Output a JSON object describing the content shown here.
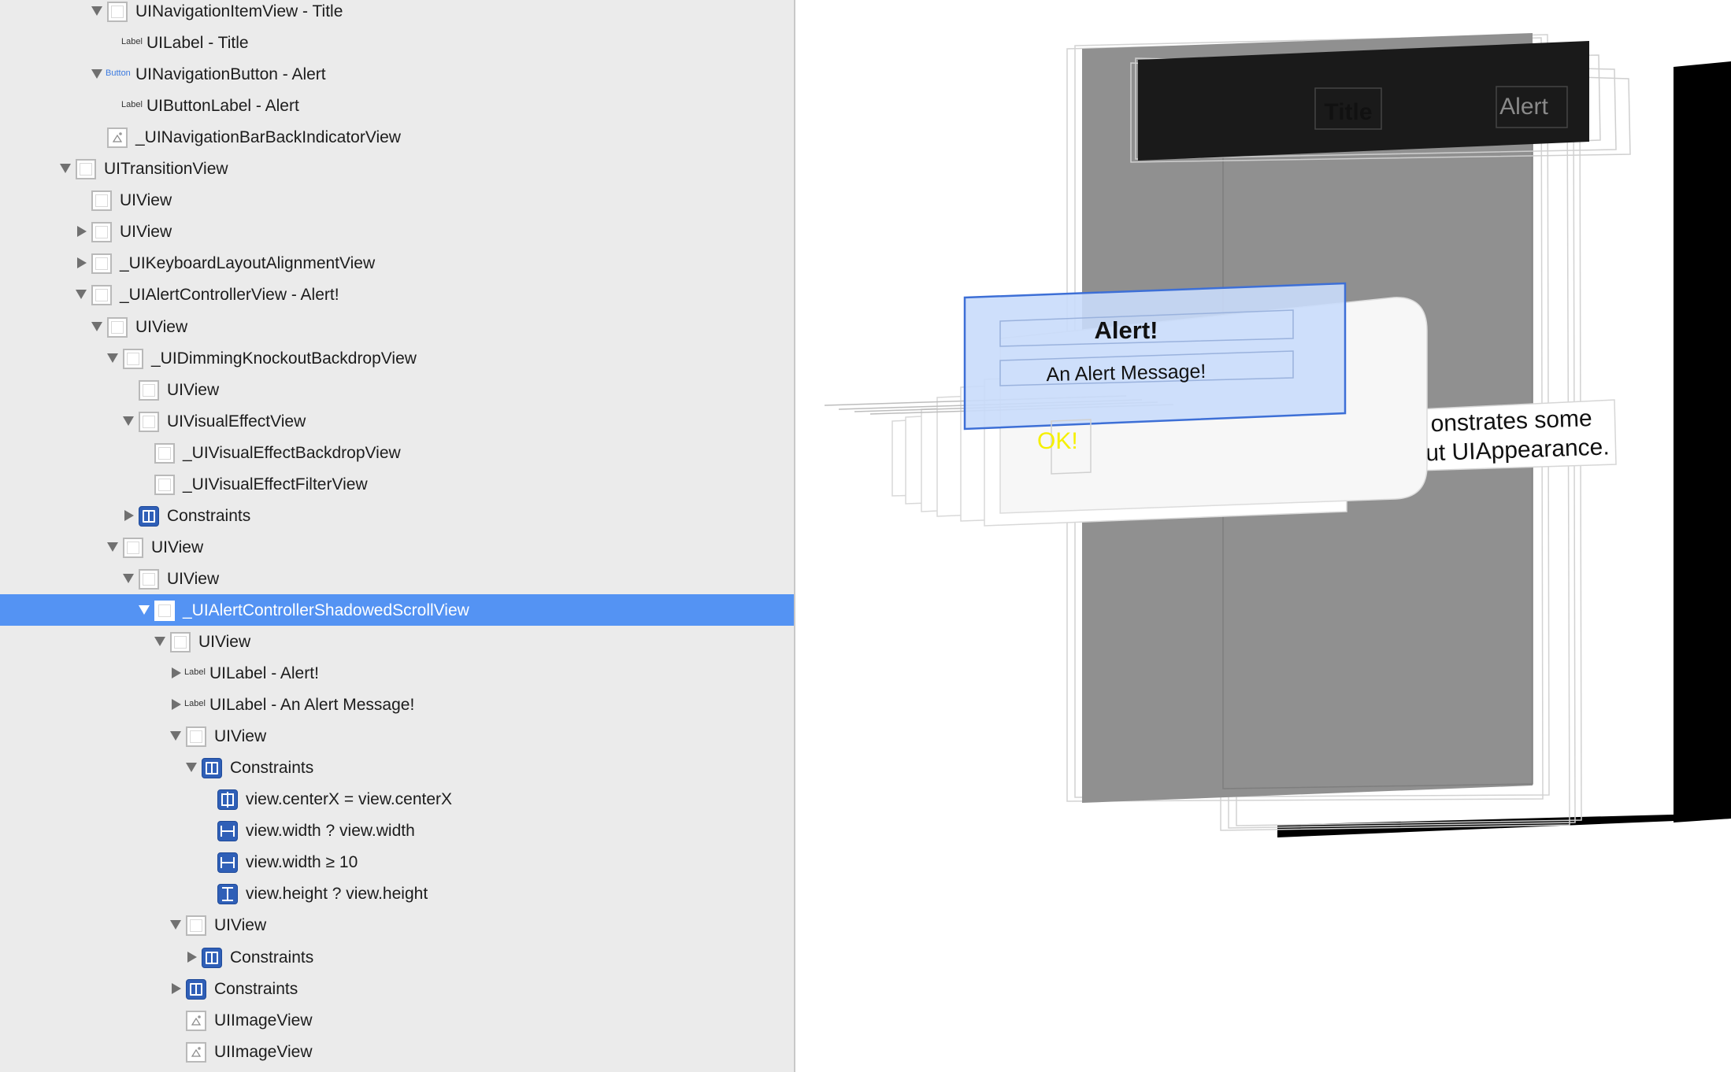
{
  "outline": {
    "rows": [
      {
        "label": "UINavigationItemView - Title",
        "expanded": true,
        "icon": "view-icon"
      },
      {
        "label": "UILabel - Title",
        "badge": "Label",
        "icon": "label-badge-icon"
      },
      {
        "label": "UINavigationButton - Alert",
        "badge": "Button",
        "expanded": true,
        "icon": "button-badge-icon"
      },
      {
        "label": "UIButtonLabel - Alert",
        "badge": "Label",
        "icon": "label-badge-icon"
      },
      {
        "label": "_UINavigationBarBackIndicatorView",
        "icon": "image-view-icon"
      },
      {
        "label": "UITransitionView",
        "expanded": true,
        "icon": "view-icon"
      },
      {
        "label": "UIView",
        "icon": "view-icon"
      },
      {
        "label": "UIView",
        "expanded": false,
        "icon": "view-icon"
      },
      {
        "label": "_UIKeyboardLayoutAlignmentView",
        "expanded": false,
        "icon": "view-icon"
      },
      {
        "label": "_UIAlertControllerView - Alert!",
        "expanded": true,
        "icon": "view-icon"
      },
      {
        "label": "UIView",
        "expanded": true,
        "icon": "view-icon"
      },
      {
        "label": "_UIDimmingKnockoutBackdropView",
        "expanded": true,
        "icon": "view-icon"
      },
      {
        "label": "UIView",
        "icon": "view-icon"
      },
      {
        "label": "UIVisualEffectView",
        "expanded": true,
        "icon": "view-icon"
      },
      {
        "label": "_UIVisualEffectBackdropView",
        "icon": "view-icon"
      },
      {
        "label": "_UIVisualEffectFilterView",
        "icon": "view-icon"
      },
      {
        "label": "Constraints",
        "expanded": false,
        "icon": "constraints-icon"
      },
      {
        "label": "UIView",
        "expanded": true,
        "icon": "view-icon"
      },
      {
        "label": "UIView",
        "expanded": true,
        "icon": "view-icon"
      },
      {
        "label": "_UIAlertControllerShadowedScrollView",
        "expanded": true,
        "icon": "view-icon",
        "selected": true
      },
      {
        "label": "UIView",
        "expanded": true,
        "icon": "view-icon"
      },
      {
        "label": "UILabel - Alert!",
        "badge": "Label",
        "expanded": false,
        "icon": "label-badge-icon"
      },
      {
        "label": "UILabel - An Alert Message!",
        "badge": "Label",
        "expanded": false,
        "icon": "label-badge-icon"
      },
      {
        "label": "UIView",
        "expanded": true,
        "icon": "view-icon"
      },
      {
        "label": "Constraints",
        "expanded": true,
        "icon": "constraints-icon"
      },
      {
        "label": "view.centerX = view.centerX",
        "icon": "center-x-constraint-icon"
      },
      {
        "label": "view.width ? view.width",
        "icon": "width-constraint-icon"
      },
      {
        "label": "view.width ≥ 10",
        "icon": "width-constraint-icon"
      },
      {
        "label": "view.height ? view.height",
        "icon": "height-constraint-icon"
      },
      {
        "label": "UIView",
        "expanded": true,
        "icon": "view-icon"
      },
      {
        "label": "Constraints",
        "expanded": false,
        "icon": "constraints-icon"
      },
      {
        "label": "Constraints",
        "expanded": false,
        "icon": "constraints-icon"
      },
      {
        "label": "UIImageView",
        "icon": "image-view-icon"
      },
      {
        "label": "UIImageView",
        "icon": "image-view-icon"
      }
    ]
  },
  "scene": {
    "nav_title": "Title",
    "nav_button": "Alert",
    "alert_title": "Alert!",
    "alert_message": "An Alert Message!",
    "ok_button": "OK!",
    "background_text_line1": "onstrates some",
    "background_text_line2": "ut UIAppearance.",
    "colors": {
      "selection": "#5493f3",
      "ok_text": "#f5f000",
      "alert_highlight": "#c9dbfb",
      "nav_bar": "#1a1a1a"
    }
  }
}
